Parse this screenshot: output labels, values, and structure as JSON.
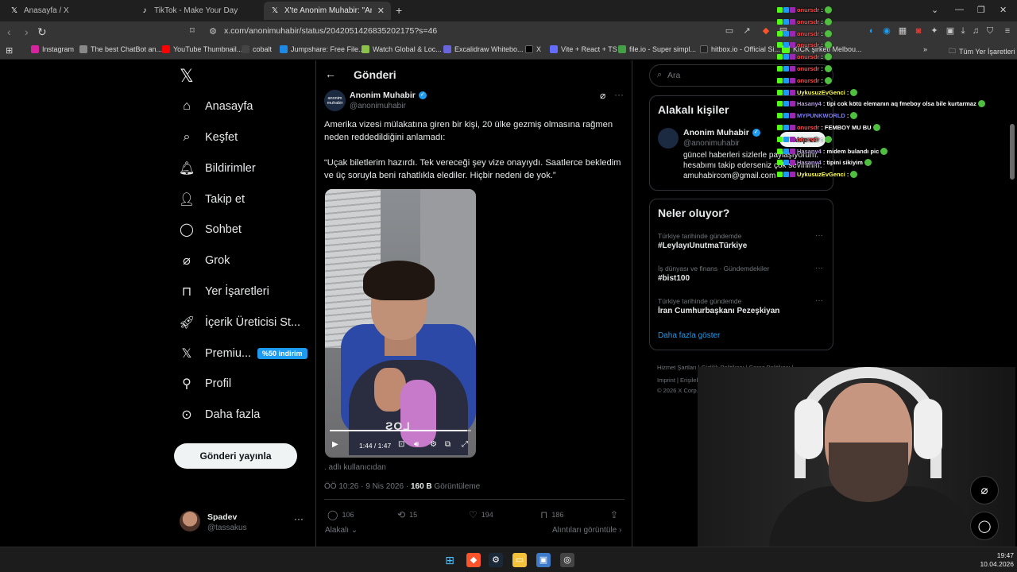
{
  "browser": {
    "tabs": [
      {
        "label": "Anasayfa / X",
        "icon": "x-logo"
      },
      {
        "label": "TikTok - Make Your Day",
        "icon": "tiktok-logo"
      },
      {
        "label": "X'te Anonim Muhabir: \"Ameri",
        "icon": "x-logo",
        "active": true
      }
    ],
    "url": "x.com/anonimuhabir/status/2042051426835202175?s=46",
    "bookmarks": [
      {
        "label": "Instagram",
        "color": "#d6249f"
      },
      {
        "label": "The best ChatBot an...",
        "color": "#888888"
      },
      {
        "label": "YouTube Thumbnail...",
        "color": "#ff0000"
      },
      {
        "label": "cobalt",
        "color": "#444444"
      },
      {
        "label": "Jumpshare: Free File...",
        "color": "#1e88e5"
      },
      {
        "label": "Watch Global & Loc...",
        "color": "#8bc34a"
      },
      {
        "label": "Excalidraw Whitebo...",
        "color": "#6965db"
      },
      {
        "label": "X",
        "color": "#000000"
      },
      {
        "label": "Vite + React + TS",
        "color": "#646cff"
      },
      {
        "label": "file.io - Super simpl...",
        "color": "#43a047"
      },
      {
        "label": "hitbox.io - Official Si...",
        "color": "#222222"
      },
      {
        "label": "KICK şirketi Melbou...",
        "color": "#53fc18"
      }
    ],
    "all_bookmarks": "Tüm Yer İşaretleri"
  },
  "sidebar": {
    "items": [
      {
        "label": "Anasayfa",
        "icon": "home-icon"
      },
      {
        "label": "Keşfet",
        "icon": "search-icon"
      },
      {
        "label": "Bildirimler",
        "icon": "bell-icon"
      },
      {
        "label": "Takip et",
        "icon": "follow-icon"
      },
      {
        "label": "Sohbet",
        "icon": "chat-icon"
      },
      {
        "label": "Grok",
        "icon": "grok-icon"
      },
      {
        "label": "Yer İşaretleri",
        "icon": "bookmark-icon"
      },
      {
        "label": "İçerik Üreticisi St...",
        "icon": "rocket-icon"
      },
      {
        "label": "Premiu...",
        "icon": "x-logo-icon"
      },
      {
        "label": "Profil",
        "icon": "profile-icon"
      },
      {
        "label": "Daha fazla",
        "icon": "more-icon"
      }
    ],
    "premium_badge": "%50 indirim",
    "post_button": "Gönderi yayınla",
    "account": {
      "name": "Spadev",
      "handle": "@tassakus"
    }
  },
  "post": {
    "header_title": "Gönderi",
    "author": "Anonim Muhabir",
    "handle": "@anonimuhabir",
    "avatar_text_1": "anonim",
    "avatar_text_2": "muhabir",
    "text_1": "Amerika vizesi mülakatına giren bir kişi, 20 ülke gezmiş olmasına rağmen neden reddedildiğini anlamadı:",
    "text_2": "“Uçak biletlerim hazırdı. Tek vereceği şey vize onayıydı. Saatlerce bekledim ve üç soruyla beni rahatlıkla elediler. Hiçbir nedeni de yok.”",
    "video": {
      "time": "1:44 / 1:47",
      "progress": 0.97
    },
    "caption": ". adlı kullanıcıdan",
    "timestamp": "ÖÖ 10:26 · 9 Nis 2026 · ",
    "views": "160 B",
    "views_label": " Görüntüleme",
    "stats": {
      "replies": "106",
      "reposts": "15",
      "likes": "194",
      "bookmarks": "186"
    },
    "related": "Alakalı",
    "quotes": "Alıntıları görüntüle"
  },
  "right": {
    "search_placeholder": "Ara",
    "related_people_title": "Alakalı kişiler",
    "person": {
      "name": "Anonim Muhabir",
      "handle": "@anonimuhabir",
      "bio": "güncel haberleri sizlerle paylaşıyorum. hesabımı takip ederseniz çok sevinirim. amuhabircom@gmail.com",
      "follow": "Takip et"
    },
    "trending_title": "Neler oluyor?",
    "trends": [
      {
        "meta": "Türkiye tarihinde gündemde",
        "name": "#LeylayıUnutmaTürkiye"
      },
      {
        "meta": "İş dünyası ve finans · Gündemdekiler",
        "name": "#bist100"
      },
      {
        "meta": "Türkiye tarihinde gündemde",
        "name": "İran Cumhurbaşkanı Pezeşkiyan"
      }
    ],
    "show_more": "Daha fazla göster",
    "footer": {
      "line1": "Hizmet Şartları  |  Gizlilik Politikası  |  Çerez Politikası  |",
      "line2": "Imprint  |  Erişilebilirlik  |  Reklam bilgisi  |  Daha fazla ···",
      "line3": "© 2026 X Corp."
    }
  },
  "chat": [
    {
      "user": "onursdr",
      "color": "#ff4d4d",
      "msg": ":"
    },
    {
      "user": "onursdr",
      "color": "#ff4d4d",
      "msg": ":"
    },
    {
      "user": "onursdr",
      "color": "#ff4d4d",
      "msg": ":"
    },
    {
      "user": "onursdr",
      "color": "#ff4d4d",
      "msg": ":"
    },
    {
      "user": "onursdr",
      "color": "#ff4d4d",
      "msg": ":"
    },
    {
      "user": "onursdr",
      "color": "#ff4d4d",
      "msg": ":"
    },
    {
      "user": "onursdr",
      "color": "#ff4d4d",
      "msg": ":"
    },
    {
      "user": "UykusuzEvGenci",
      "color": "#ffff55",
      "msg": ":"
    },
    {
      "user": "Hasany4",
      "color": "#b39ddb",
      "msg": ": tipi cok kötü elemanın aq fmeboy olsa bile kurtarmaz"
    },
    {
      "user": "MYPUNKWORLD",
      "color": "#7c7cff",
      "msg": ":"
    },
    {
      "user": "onursdr",
      "color": "#ff4d4d",
      "msg": ": FEMBOY MU BU"
    },
    {
      "user": "onursdr",
      "color": "#ff4d4d",
      "msg": ":"
    },
    {
      "user": "Hasany4",
      "color": "#b39ddb",
      "msg": ": midem bulandı pic"
    },
    {
      "user": "Hasany4",
      "color": "#b39ddb",
      "msg": ": tipini sikiyim"
    },
    {
      "user": "UykusuzEvGenci",
      "color": "#ffff55",
      "msg": ":"
    }
  ],
  "taskbar": {
    "time": "19:47",
    "date": "10.04.2026"
  }
}
